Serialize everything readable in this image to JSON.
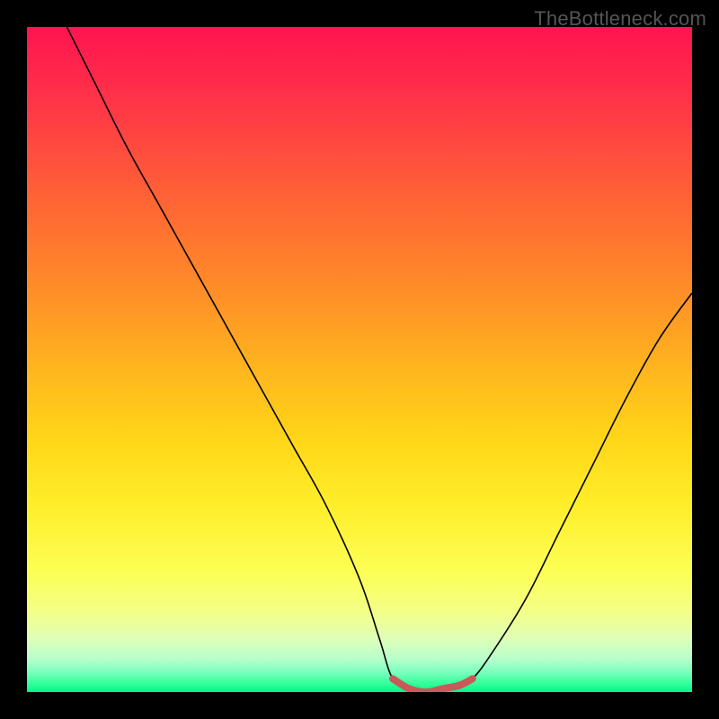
{
  "watermark": "TheBottleneck.com",
  "gradient_colors": {
    "top": "#ff1450",
    "mid": "#ffe030",
    "bottom": "#00f58a"
  },
  "curve": {
    "stroke": "#000000",
    "stroke_width": 1.6,
    "highlight_stroke": "#c85a5a",
    "highlight_width": 8
  },
  "chart_data": {
    "type": "line",
    "title": "",
    "xlabel": "",
    "ylabel": "",
    "xlim": [
      0,
      100
    ],
    "ylim": [
      0,
      100
    ],
    "grid": false,
    "legend": false,
    "annotations": [
      "TheBottleneck.com"
    ],
    "series": [
      {
        "name": "bottleneck-curve",
        "x": [
          6,
          10,
          15,
          20,
          25,
          30,
          35,
          40,
          45,
          50,
          53,
          55,
          57.5,
          60,
          62.5,
          65,
          67,
          70,
          75,
          80,
          85,
          90,
          95,
          100
        ],
        "y": [
          100,
          92,
          82,
          73,
          64,
          55,
          46,
          37,
          28,
          17,
          8,
          2,
          0.5,
          0,
          0.5,
          1,
          2,
          6,
          14,
          24,
          34,
          44,
          53,
          60
        ]
      },
      {
        "name": "optimal-region",
        "x": [
          55,
          57.5,
          60,
          62.5,
          65,
          67
        ],
        "y": [
          2,
          0.5,
          0,
          0.5,
          1,
          2
        ]
      }
    ]
  }
}
